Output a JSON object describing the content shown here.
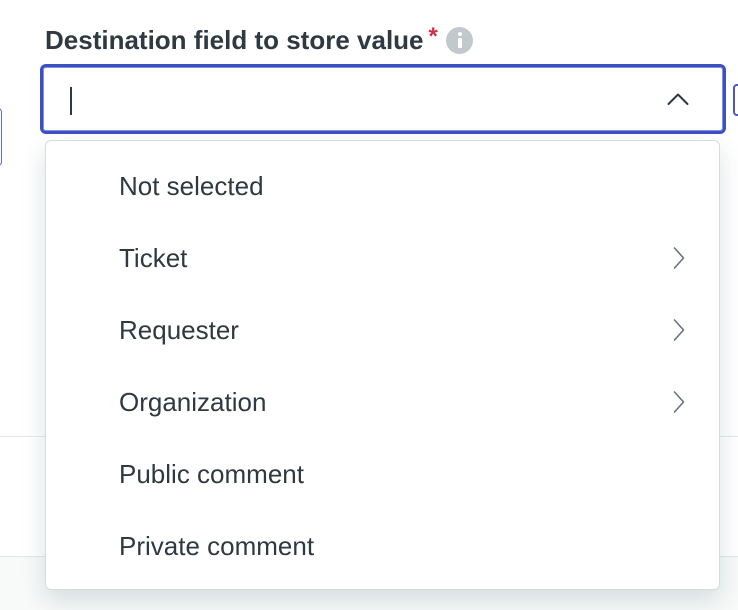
{
  "field": {
    "label": "Destination field to store value",
    "required_mark": "*",
    "info_icon": "info-icon",
    "value": ""
  },
  "dropdown": {
    "expanded": true,
    "toggle_icon": "chevron-up-icon",
    "options": [
      {
        "label": "Not selected",
        "has_submenu": false
      },
      {
        "label": "Ticket",
        "has_submenu": true
      },
      {
        "label": "Requester",
        "has_submenu": true
      },
      {
        "label": "Organization",
        "has_submenu": true
      },
      {
        "label": "Public comment",
        "has_submenu": false
      },
      {
        "label": "Private comment",
        "has_submenu": false
      }
    ]
  },
  "colors": {
    "focus_border": "#3d4fc4",
    "required": "#cc3340",
    "text": "#2f3941",
    "info_icon_bg": "#c2c8cc"
  }
}
